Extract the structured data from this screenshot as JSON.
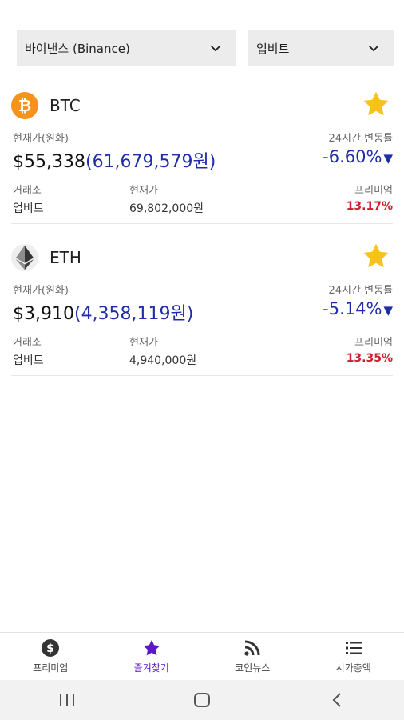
{
  "selectors": {
    "left": "바이낸스 (Binance)",
    "right": "업비트"
  },
  "labels": {
    "current_price": "현재가(원화)",
    "change_24h": "24시간 변동률",
    "exchange": "거래소",
    "price": "현재가",
    "premium": "프리미엄"
  },
  "coins": [
    {
      "symbol": "BTC",
      "logo_icon": "bitcoin-icon",
      "logo_color": "#f7931a",
      "favorite": true,
      "usd_price": "$55,338",
      "krw_price": "(61,679,579원)",
      "change": "-6.60%",
      "exchange": "업비트",
      "exchange_price": "69,802,000원",
      "premium": "13.17%"
    },
    {
      "symbol": "ETH",
      "logo_icon": "ethereum-icon",
      "logo_color": "#3c3c3d",
      "favorite": true,
      "usd_price": "$3,910",
      "krw_price": "(4,358,119원)",
      "change": "-5.14%",
      "exchange": "업비트",
      "exchange_price": "4,940,000원",
      "premium": "13.35%"
    }
  ],
  "tabs": [
    {
      "label": "프리미엄",
      "icon": "dollar-coin-icon",
      "active": false
    },
    {
      "label": "즐겨찾기",
      "icon": "star-icon",
      "active": true
    },
    {
      "label": "코인뉴스",
      "icon": "rss-feed-icon",
      "active": false
    },
    {
      "label": "시가총액",
      "icon": "list-icon",
      "active": false
    }
  ],
  "colors": {
    "accent": "#5b17c9",
    "price_blue": "#1f2ea8",
    "premium_red": "#d11b2b",
    "star_gold": "#f6c21c"
  }
}
